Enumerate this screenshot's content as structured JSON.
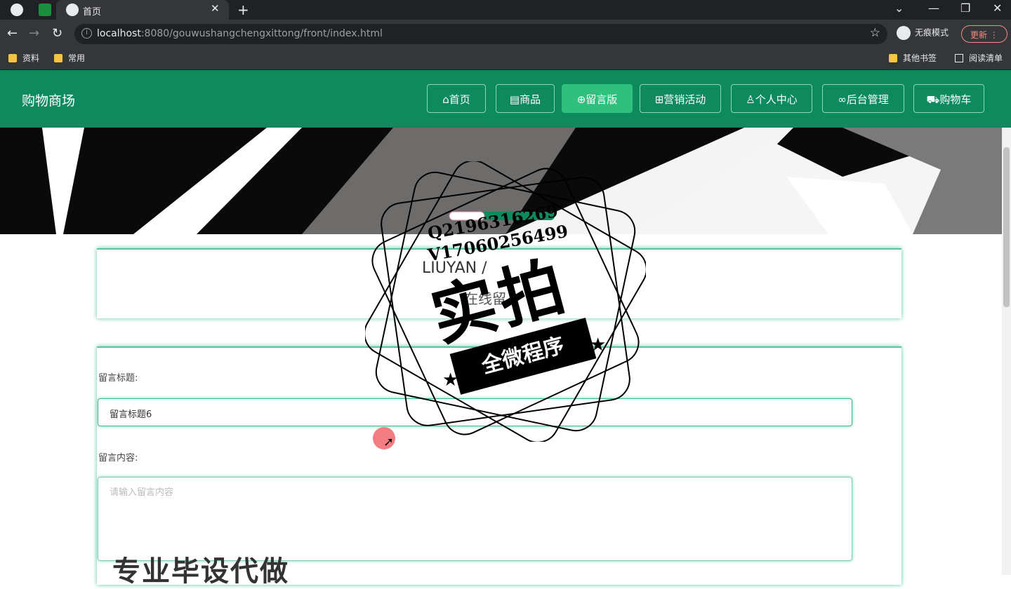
{
  "browser": {
    "tab_title": "首页",
    "url_host": "localhost",
    "url_rest": ":8080/gouwushangchengxittong/front/index.html",
    "incognito_label": "无痕模式",
    "update_label": "更新",
    "bookmarks": [
      "资料",
      "常用"
    ],
    "other_bookmarks": "其他书签",
    "reading_list": "阅读清单"
  },
  "header": {
    "logo": "购物商场",
    "nav": [
      {
        "label": "首页",
        "icon": "home-icon"
      },
      {
        "label": "商品",
        "icon": "calendar-icon"
      },
      {
        "label": "留言版",
        "icon": "globe-icon",
        "active": true
      },
      {
        "label": "营销活动",
        "icon": "grid-icon"
      },
      {
        "label": "个人中心",
        "icon": "user-icon"
      },
      {
        "label": "后台管理",
        "icon": "link-icon"
      },
      {
        "label": "购物车",
        "icon": "cart-icon"
      }
    ]
  },
  "section": {
    "title_en": "LIUYAN / ",
    "title_cn": "在线留"
  },
  "form": {
    "title_label": "留言标题:",
    "title_value": "留言标题6",
    "content_label": "留言内容:",
    "content_placeholder": "请输入留言内容"
  },
  "overlay": {
    "line1": "Q2196316269",
    "line2": "V17060256499",
    "big": "实拍",
    "ribbon": "全微程序",
    "bottom_text": "专业毕设代做"
  },
  "colors": {
    "header_bg": "#0e8a5f",
    "nav_active": "#2ec07c",
    "accent": "#59c4a1"
  }
}
